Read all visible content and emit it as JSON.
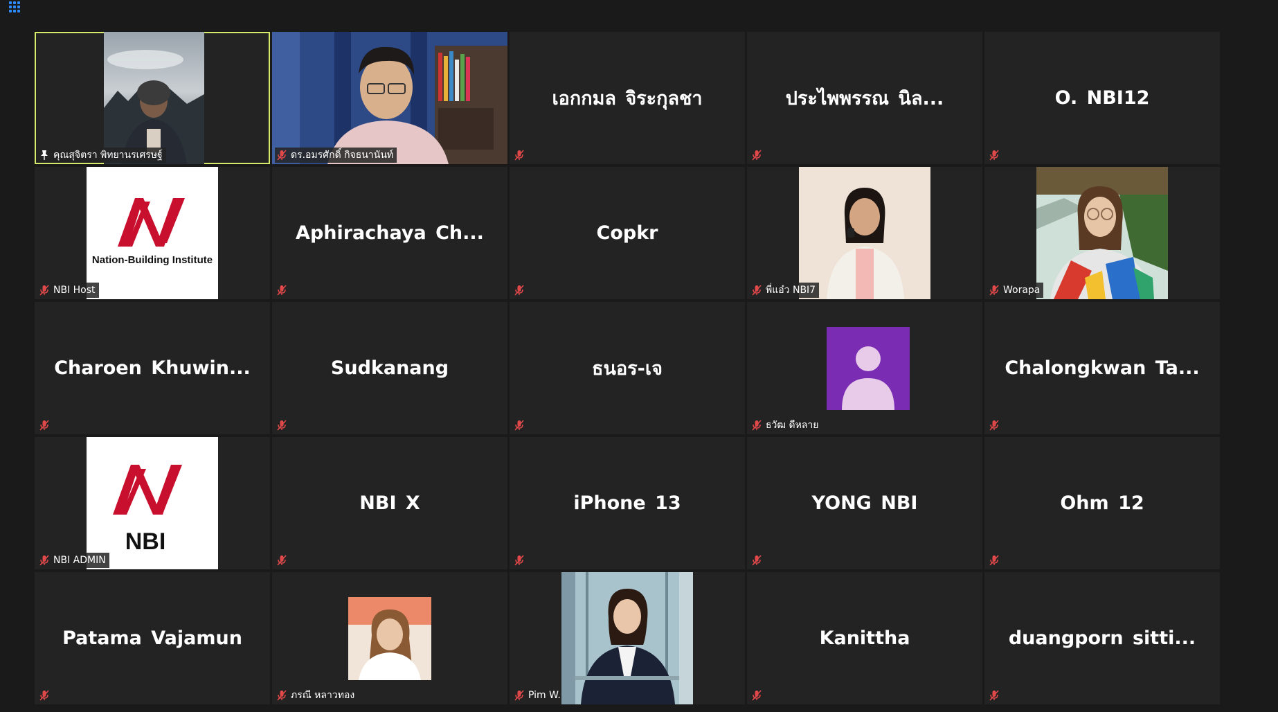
{
  "meeting": {
    "view_icon": "grid-view-icon",
    "accent_color": "#2d8cff",
    "active_speaker_color": "#d7ea6a",
    "muted_icon": "mic-muted-icon",
    "pinned_icon": "pin-icon"
  },
  "participants": [
    {
      "label": "คุณสุจิตรา  พิทยานรเศรษฐ์",
      "video": "camera",
      "muted": false,
      "pinned": true,
      "active_speaker": true
    },
    {
      "label": "ดร.อมรศักดิ์  กิจธนานันท์",
      "video": "camera",
      "muted": true
    },
    {
      "display_name": "เอกกมล จิระกุลชา",
      "video": "off",
      "muted": true
    },
    {
      "display_name": "ประไพพรรณ นิล...",
      "video": "off",
      "muted": true
    },
    {
      "display_name": "O. NBI12",
      "video": "off",
      "muted": true
    },
    {
      "label": "NBI Host",
      "video": "logo",
      "logo_text": "Nation-Building Institute",
      "muted": true
    },
    {
      "display_name": "Aphirachaya  Ch...",
      "video": "off",
      "muted": true
    },
    {
      "display_name": "Copkr",
      "video": "off",
      "muted": true
    },
    {
      "label": "พี่แอ๋ว NBI7",
      "video": "photo",
      "muted": true
    },
    {
      "label": "Worapa",
      "video": "photo",
      "muted": true
    },
    {
      "display_name": "Charoen  Khuwin...",
      "video": "off",
      "muted": true
    },
    {
      "display_name": "Sudkanang",
      "video": "off",
      "muted": true
    },
    {
      "display_name": "ธนอร-เจ",
      "video": "off",
      "muted": true
    },
    {
      "label": "ธวัฒ ดีหลาย",
      "video": "avatar",
      "muted": true
    },
    {
      "display_name": "Chalongkwan  Ta...",
      "video": "off",
      "muted": true
    },
    {
      "label": "NBI ADMIN",
      "video": "logo",
      "logo_text": "NBI",
      "muted": true
    },
    {
      "display_name": "NBI X",
      "video": "off",
      "muted": true
    },
    {
      "display_name": "iPhone 13",
      "video": "off",
      "muted": true
    },
    {
      "display_name": "YONG NBI",
      "video": "off",
      "muted": true
    },
    {
      "display_name": "Ohm 12",
      "video": "off",
      "muted": true
    },
    {
      "display_name": "Patama Vajamun",
      "video": "off",
      "muted": true
    },
    {
      "label": "ภรณี หลาวทอง",
      "video": "photo",
      "muted": true
    },
    {
      "label": "Pim W.",
      "video": "photo",
      "muted": true
    },
    {
      "display_name": "Kanittha",
      "video": "off",
      "muted": true
    },
    {
      "display_name": "duangporn  sitti...",
      "video": "off",
      "muted": true
    }
  ]
}
